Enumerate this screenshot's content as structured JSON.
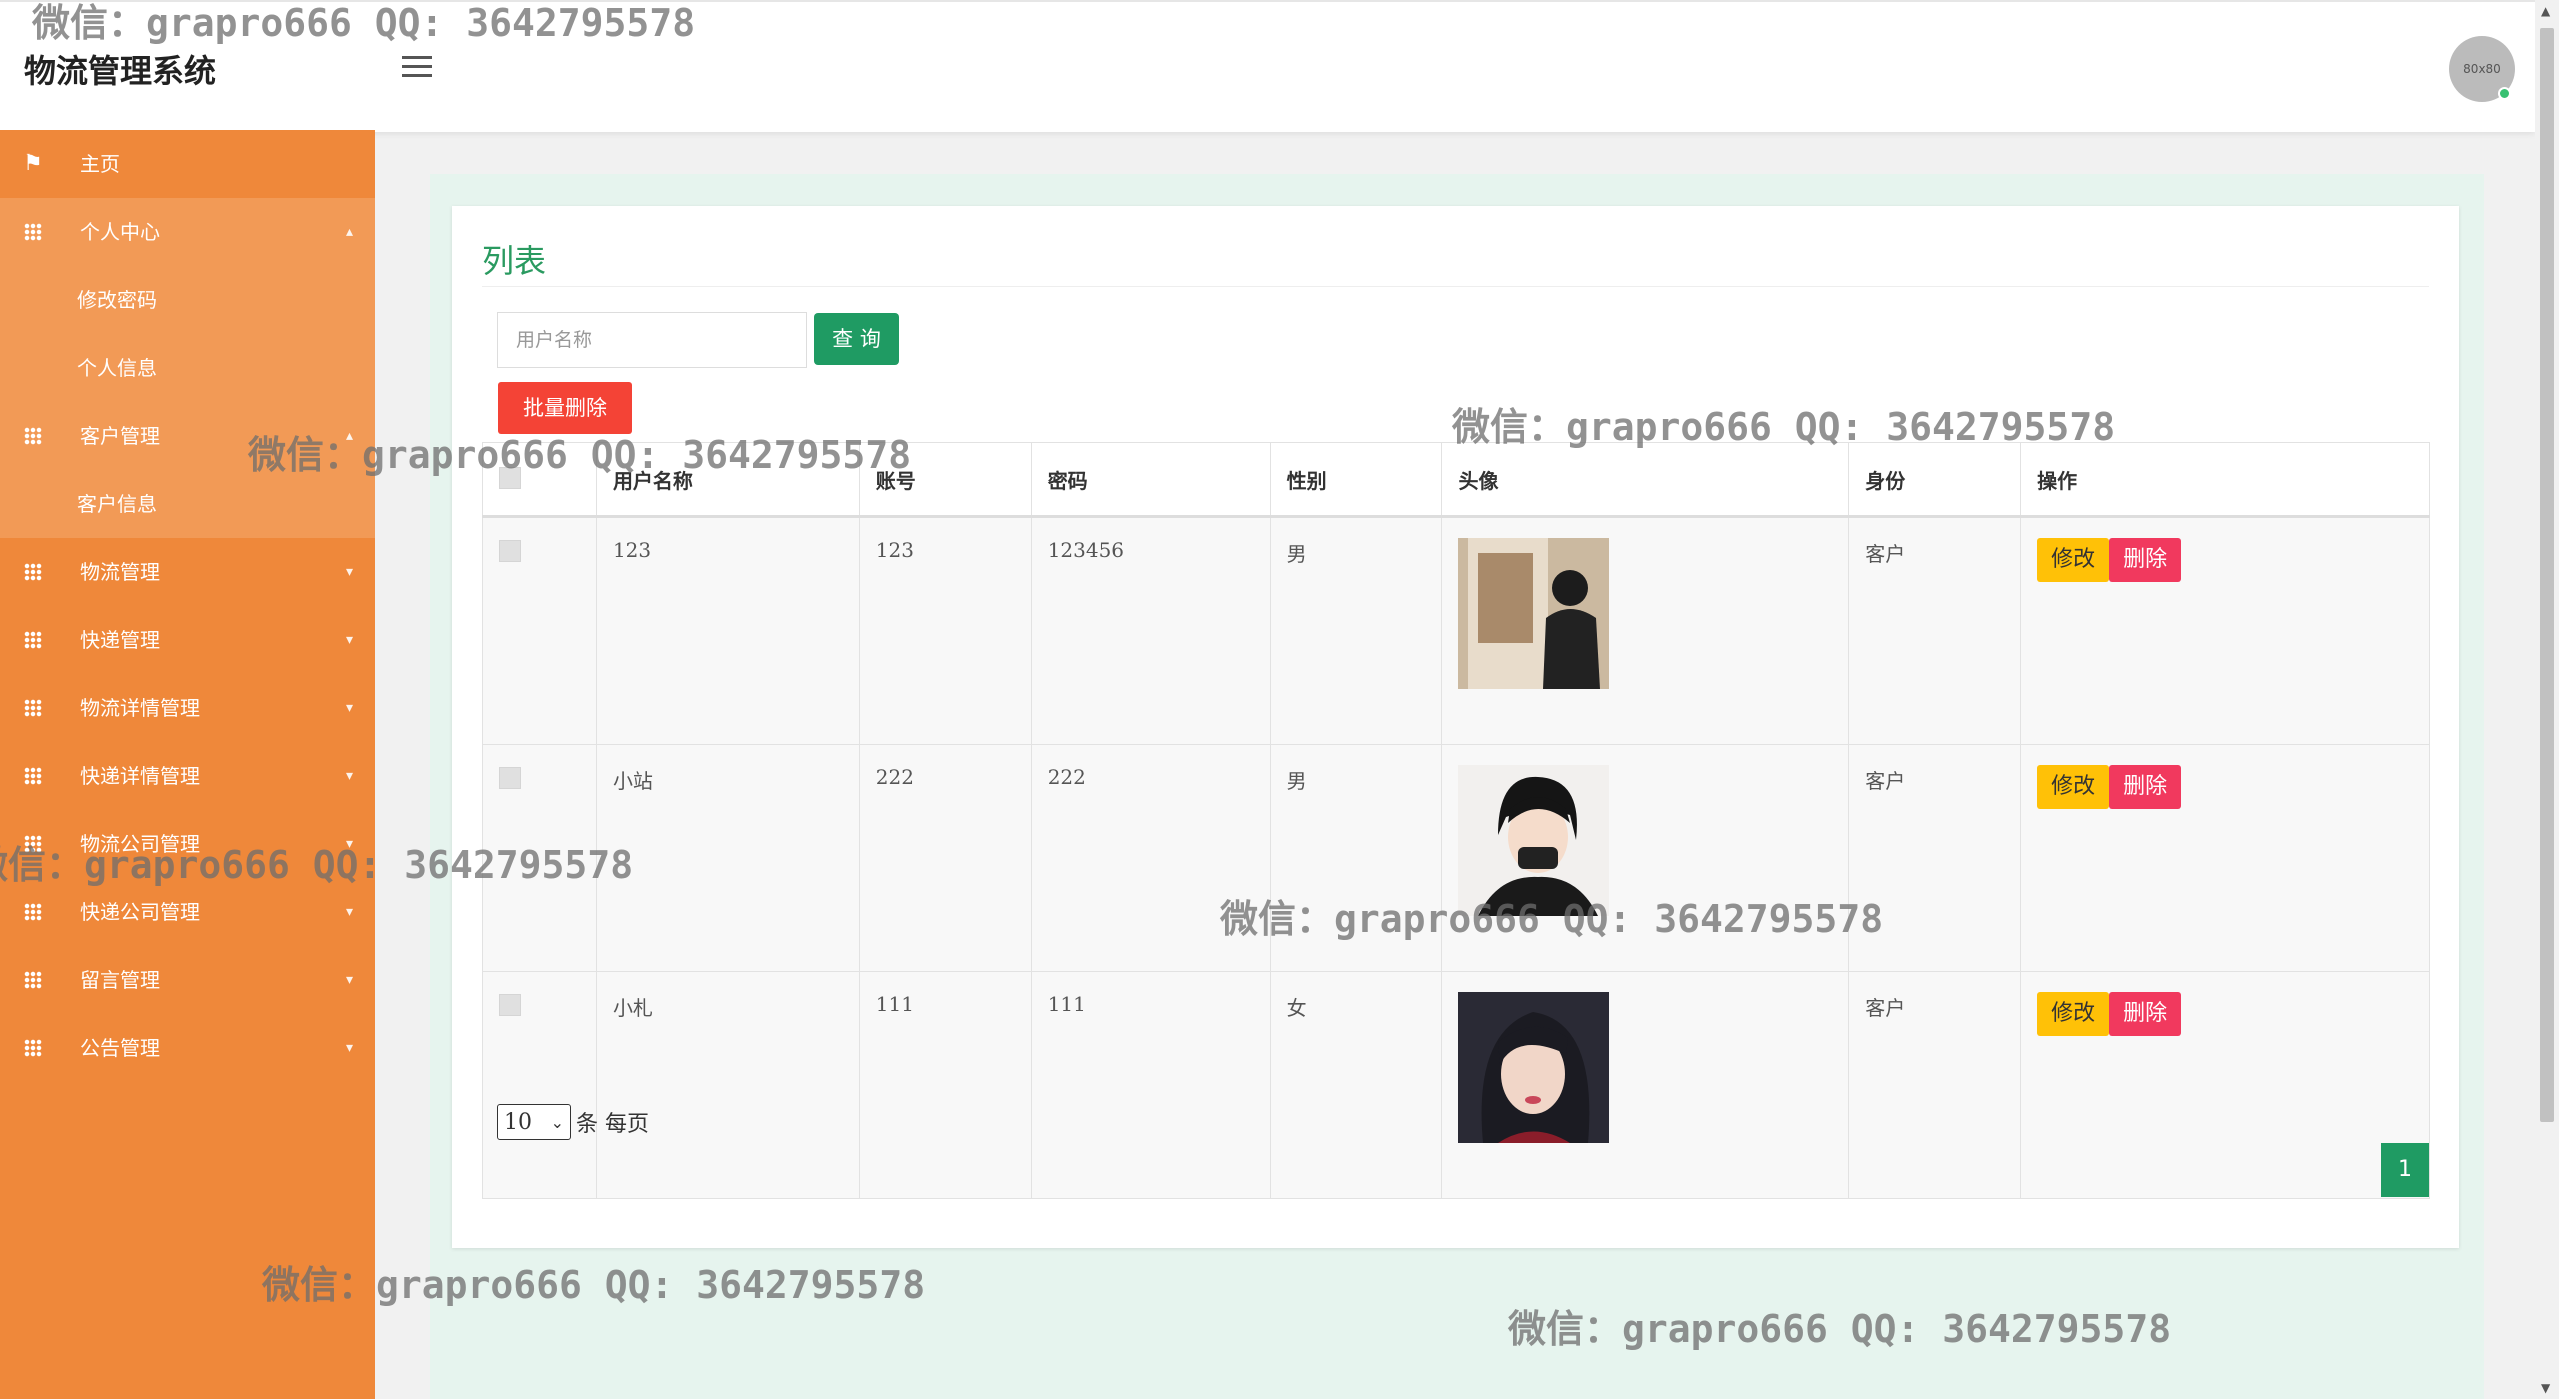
{
  "header": {
    "app_title": "物流管理系统",
    "avatar_text": "80x80"
  },
  "sidebar": {
    "home": "主页",
    "groups": [
      {
        "label": "个人中心",
        "children": [
          "修改密码",
          "个人信息"
        ]
      },
      {
        "label": "客户管理",
        "children": [
          "客户信息"
        ]
      },
      {
        "label": "物流管理"
      },
      {
        "label": "快递管理"
      },
      {
        "label": "物流详情管理"
      },
      {
        "label": "快递详情管理"
      },
      {
        "label": "物流公司管理"
      },
      {
        "label": "快递公司管理"
      },
      {
        "label": "留言管理"
      },
      {
        "label": "公告管理"
      }
    ]
  },
  "main": {
    "title": "列表",
    "search_placeholder": "用户名称",
    "query_label": "查 询",
    "batch_delete_label": "批量删除",
    "columns": [
      "用户名称",
      "账号",
      "密码",
      "性别",
      "头像",
      "身份",
      "操作"
    ],
    "rows": [
      {
        "name": "123",
        "account": "123",
        "password": "123456",
        "gender": "男",
        "role": "客户"
      },
      {
        "name": "小站",
        "account": "222",
        "password": "222",
        "gender": "男",
        "role": "客户"
      },
      {
        "name": "小札",
        "account": "111",
        "password": "111",
        "gender": "女",
        "role": "客户"
      }
    ],
    "edit_label": "修改",
    "delete_label": "删除",
    "page_size": "10",
    "page_size_label": "条 每页",
    "current_page": "1"
  },
  "watermark": {
    "text": "微信：grapro666 QQ: 3642795578"
  },
  "colors": {
    "sidebar": "#ef883a",
    "accent_green": "#1f9b63",
    "danger": "#f44336",
    "warning": "#ffc107"
  }
}
